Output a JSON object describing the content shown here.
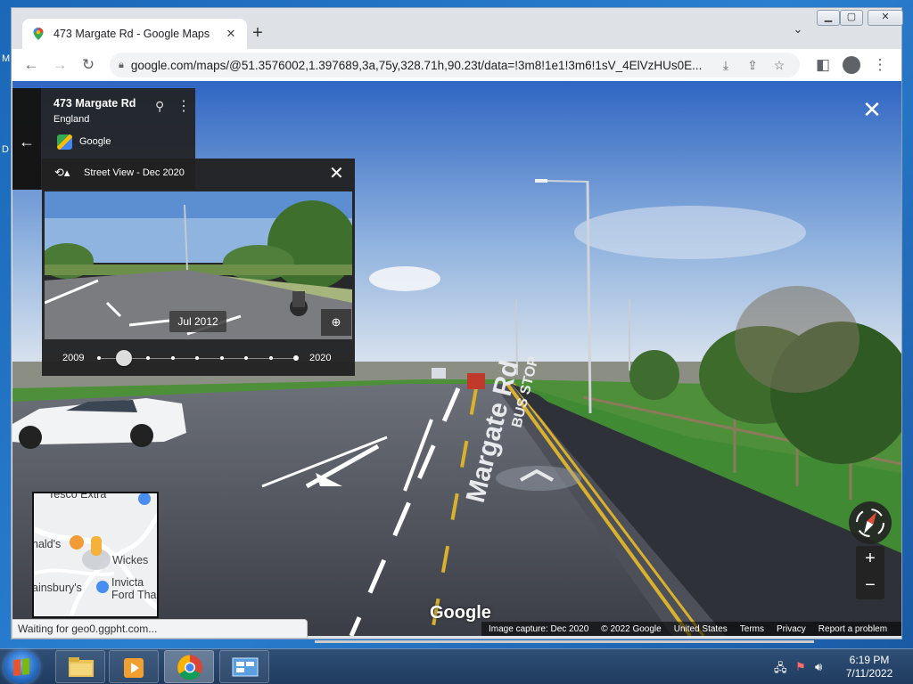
{
  "browser": {
    "tab_title": "473 Margate Rd - Google Maps",
    "tab_close": "✕",
    "new_tab": "+",
    "url": "google.com/maps/@51.3576002,1.397689,3a,75y,328.71h,90.23t/data=!3m8!1e1!3m6!1sV_4ElVzHUs0E..."
  },
  "address_card": {
    "address": "473 Margate Rd",
    "country": "England",
    "source": "Google"
  },
  "time_panel": {
    "label": "Street View - Dec 2020",
    "thumbnail_date": "Jul 2012",
    "year_start": "2009",
    "year_end": "2020",
    "capture_count": 9,
    "selected_capture": 2
  },
  "minimap": {
    "labels": [
      "Tesco Extra",
      "nald's",
      "Wickes",
      "ainsbury's",
      "Invicta",
      "Ford Tha"
    ]
  },
  "street_scene": {
    "road_text": "Margate Rd",
    "bus_stop_text": "BUS STOP"
  },
  "map_brand": "Google",
  "attribution": {
    "capture": "Image capture: Dec 2020",
    "copyright": "© 2022 Google",
    "region": "United States",
    "terms": "Terms",
    "privacy": "Privacy",
    "report": "Report a problem"
  },
  "status_text": "Waiting for geo0.ggpht.com...",
  "taskbar": {
    "time": "6:19 PM",
    "date": "7/11/2022"
  },
  "colors": {
    "chrome_bg": "#dee1e6",
    "panel_dark": "#212121",
    "taskbar": "#1f3b5f",
    "road_line_yellow": "#d9b12c"
  }
}
